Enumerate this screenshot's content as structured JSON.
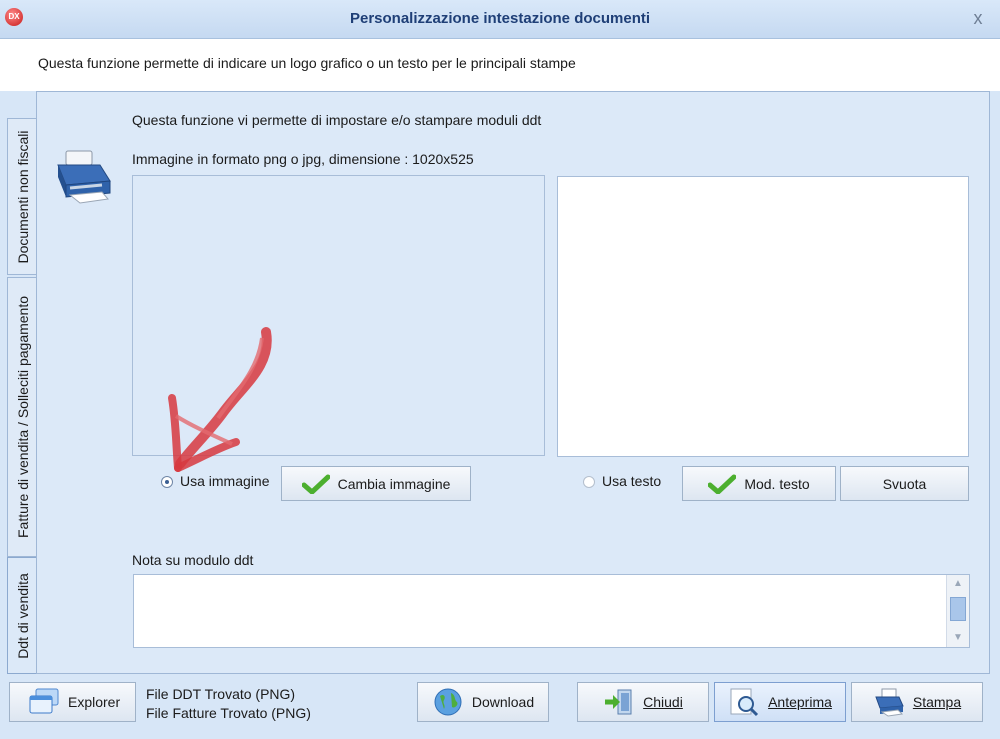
{
  "window": {
    "title": "Personalizzazione intestazione documenti",
    "app_icon_text": "DX",
    "close_label": "x"
  },
  "header": {
    "description": "Questa funzione permette di indicare un logo grafico o un testo per le principali stampe"
  },
  "tabs": [
    {
      "label": "Documenti non fiscali",
      "active": false
    },
    {
      "label": "Fatture di vendita / Solleciti pagamento",
      "active": false
    },
    {
      "label": "Ddt di vendita",
      "active": true
    }
  ],
  "content": {
    "intro": "Questa funzione vi permette di impostare e/o stampare moduli ddt",
    "image_info": "Immagine in formato png o jpg, dimensione : 1020x525",
    "use_image_label": "Usa immagine",
    "use_image_checked": true,
    "change_image_label": "Cambia immagine",
    "use_text_label": "Usa testo",
    "use_text_checked": false,
    "edit_text_label": "Mod. testo",
    "clear_label": "Svuota",
    "note_label": "Nota su modulo ddt",
    "note_value": ""
  },
  "footer": {
    "explorer_label": "Explorer",
    "file_status_1": "File DDT Trovato (PNG)",
    "file_status_2": "File Fatture Trovato (PNG)",
    "download_label": "Download",
    "close_label": "Chiudi",
    "preview_label": "Anteprima",
    "print_label": "Stampa"
  },
  "colors": {
    "title_text": "#1f3f77",
    "panel_bg": "#dce9f8",
    "annotation_arrow": "#d7383f",
    "check_green": "#4caf2f"
  }
}
